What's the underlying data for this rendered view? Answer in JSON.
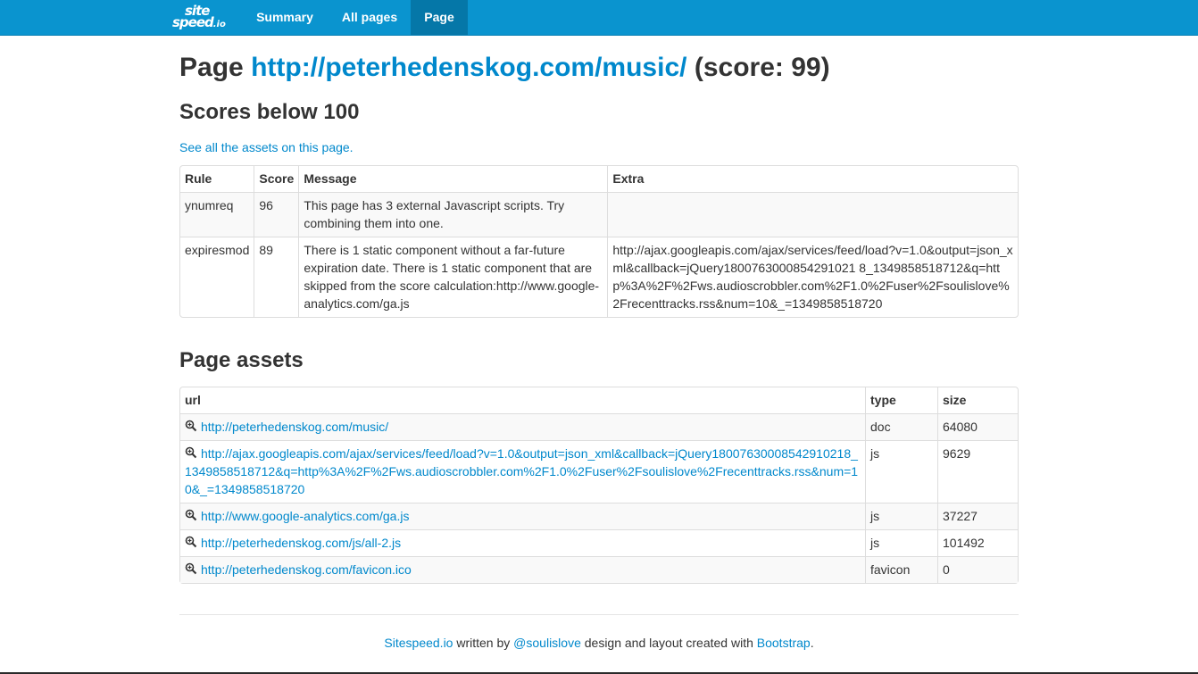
{
  "nav": {
    "brand_line1": "site",
    "brand_line2": "speed",
    "brand_suffix": ".io",
    "items": [
      {
        "label": "Summary"
      },
      {
        "label": "All pages"
      },
      {
        "label": "Page",
        "active": true
      }
    ],
    "bar_color": "#0a94cf",
    "active_color": "#0577a8"
  },
  "page": {
    "title_prefix": "Page",
    "url": "http://peterhedenskog.com/music/",
    "title_suffix": "(score: 99)"
  },
  "scores": {
    "heading": "Scores below 100",
    "assets_link": "See all the assets on this page.",
    "columns": [
      "Rule",
      "Score",
      "Message",
      "Extra"
    ],
    "rows": [
      {
        "rule": "ynumreq",
        "score": "96",
        "message": "This page has 3 external Javascript scripts. Try combining them into one.",
        "extra": ""
      },
      {
        "rule": "expiresmod",
        "score": "89",
        "message": "There is 1 static component without a far-future expiration date. There is 1 static component that are skipped from the score calculation:http://www.google-analytics.com/ga.js",
        "extra": "http://ajax.googleapis.com/ajax/services/feed/load?v=1.0&output=json_xml&callback=jQuery1800763000854291021 8_1349858518712&q=http%3A%2F%2Fws.audioscrobbler.com%2F1.0%2Fuser%2Fsoulislove%2Frecenttracks.rss&num=10&_=1349858518720"
      }
    ]
  },
  "assets": {
    "heading": "Page assets",
    "columns": [
      "url",
      "type",
      "size"
    ],
    "icon": "zoom-in-icon",
    "rows": [
      {
        "url": "http://peterhedenskog.com/music/",
        "type": "doc",
        "size": "64080"
      },
      {
        "url": "http://ajax.googleapis.com/ajax/services/feed/load?v=1.0&output=json_xml&callback=jQuery18007630008542910218_1349858518712&q=http%3A%2F%2Fws.audioscrobbler.com%2F1.0%2Fuser%2Fsoulislove%2Frecenttracks.rss&num=10&_=1349858518720",
        "type": "js",
        "size": "9629"
      },
      {
        "url": "http://www.google-analytics.com/ga.js",
        "type": "js",
        "size": "37227"
      },
      {
        "url": "http://peterhedenskog.com/js/all-2.js",
        "type": "js",
        "size": "101492"
      },
      {
        "url": "http://peterhedenskog.com/favicon.ico",
        "type": "favicon",
        "size": "0"
      }
    ]
  },
  "footer": {
    "link1": "Sitespeed.io",
    "text1": "written by",
    "link2": "@soulislove",
    "text2": "design and layout created with",
    "link3": "Bootstrap",
    "text3": "."
  }
}
